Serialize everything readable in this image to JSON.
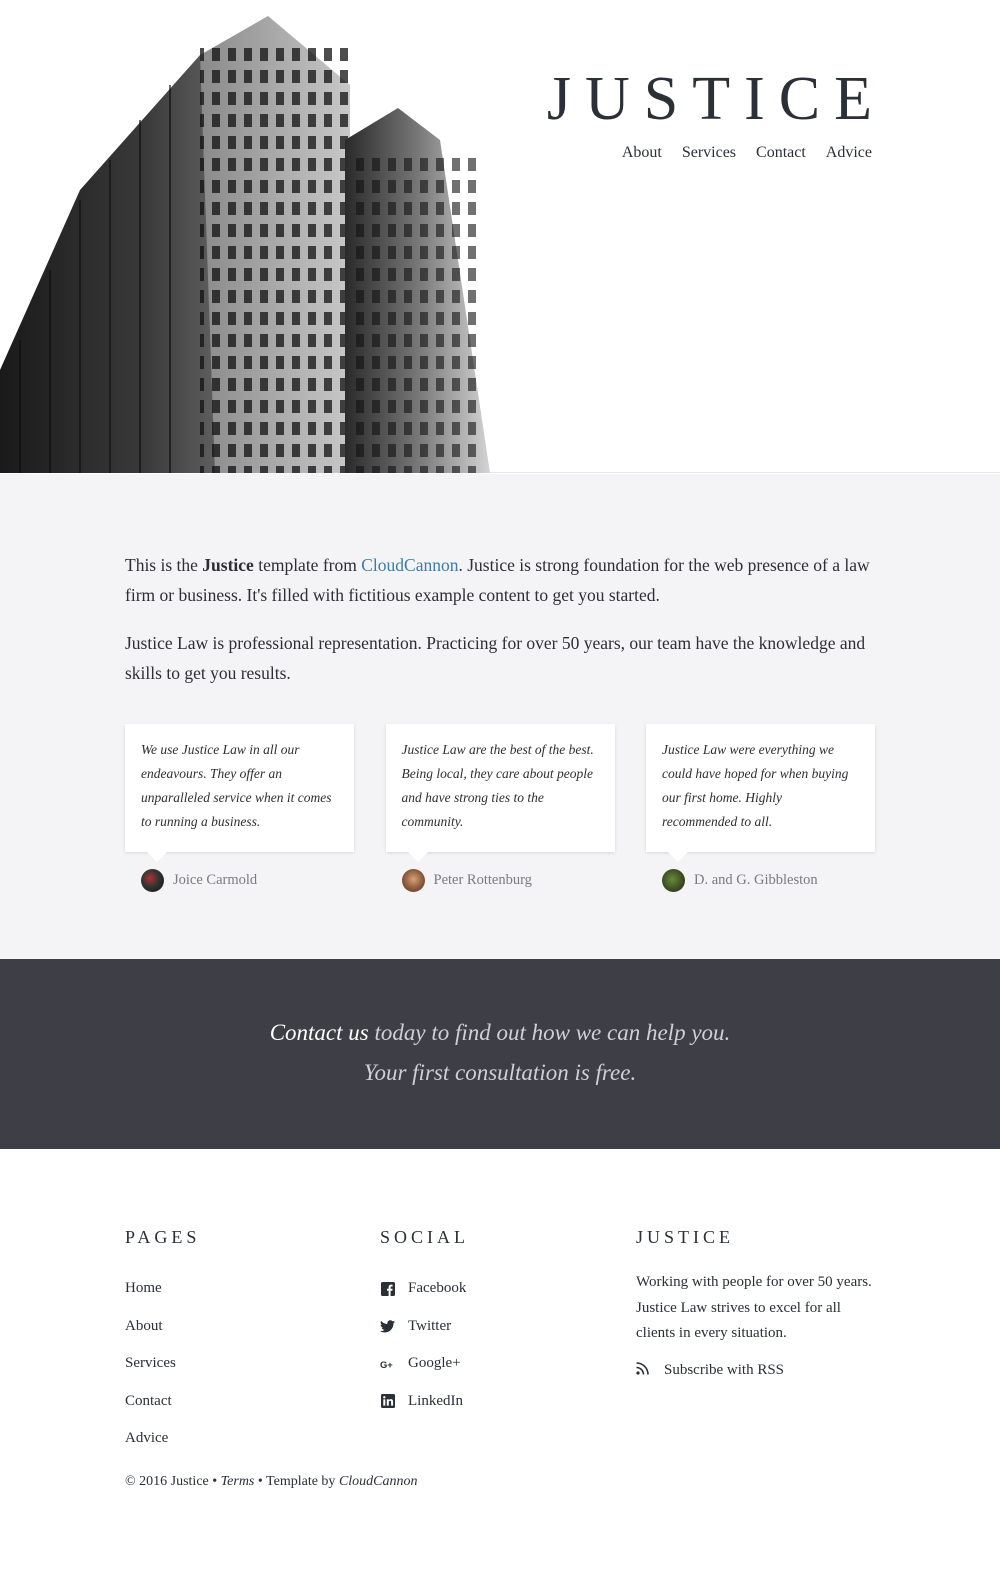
{
  "site": {
    "logo": "JUSTICE"
  },
  "nav": {
    "items": [
      {
        "label": "About"
      },
      {
        "label": "Services"
      },
      {
        "label": "Contact"
      },
      {
        "label": "Advice"
      }
    ]
  },
  "intro": {
    "p1_before": "This is the ",
    "p1_bold": "Justice",
    "p1_mid": " template from ",
    "p1_link": "CloudCannon",
    "p1_after": ". Justice is strong foundation for the web presence of a law firm or business. It's filled with fictitious example content to get you started.",
    "p2": "Justice Law is professional representation. Practicing for over 50 years, our team have the knowledge and skills to get you results."
  },
  "testimonials": [
    {
      "quote": "We use Justice Law in all our endeavours. They offer an unparalleled service when it comes to running a business.",
      "author": "Joice Carmold"
    },
    {
      "quote": "Justice Law are the best of the best. Being local, they care about people and have strong ties to the community.",
      "author": "Peter Rottenburg"
    },
    {
      "quote": "Justice Law were everything we could have hoped for when buying our first home. Highly recommended to all.",
      "author": "D. and G. Gibbleston"
    }
  ],
  "cta": {
    "link": "Contact us",
    "line1_rest": " today to find out how we can help you.",
    "line2": "Your first consultation is free."
  },
  "footer": {
    "pages": {
      "heading": "PAGES",
      "items": [
        "Home",
        "About",
        "Services",
        "Contact",
        "Advice"
      ]
    },
    "social": {
      "heading": "SOCIAL",
      "items": [
        {
          "label": "Facebook",
          "icon": "facebook-icon"
        },
        {
          "label": "Twitter",
          "icon": "twitter-icon"
        },
        {
          "label": "Google+",
          "icon": "google-plus-icon"
        },
        {
          "label": "LinkedIn",
          "icon": "linkedin-icon"
        }
      ]
    },
    "about": {
      "heading": "JUSTICE",
      "text": "Working with people for over 50 years. Justice Law strives to excel for all clients in every situation.",
      "rss": "Subscribe with RSS"
    },
    "copyright": {
      "prefix": "© 2016 Justice • ",
      "terms": "Terms",
      "mid": " • Template by ",
      "by": "CloudCannon"
    }
  },
  "colors": {
    "link": "#3a7ca5",
    "cta_bg": "#3e3f46",
    "intro_bg": "#f4f4f6",
    "text": "#2b2f36"
  }
}
